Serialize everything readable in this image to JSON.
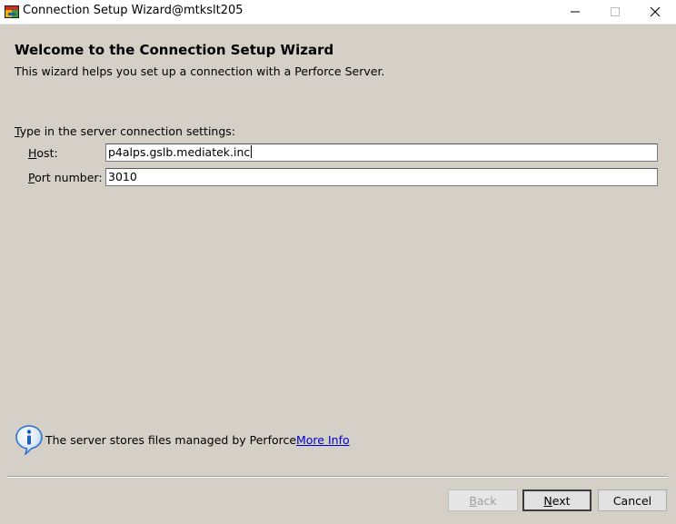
{
  "window": {
    "title": "Connection Setup Wizard@mtkslt205"
  },
  "wizard": {
    "heading": "Welcome to the Connection Setup Wizard",
    "subtitle": "This wizard helps you set up a connection with a Perforce Server.",
    "section_label_first": "T",
    "section_label_rest": "ype in the server connection settings:",
    "host": {
      "label_first": "H",
      "label_rest": "ost:",
      "value": "p4alps.gslb.mediatek.inc"
    },
    "port": {
      "label_first": "P",
      "label_rest": "ort number:",
      "value": "3010"
    },
    "info": {
      "text": "The server stores files managed by Perforce.",
      "link": "More Info",
      "icon": "info-icon"
    }
  },
  "buttons": {
    "back_first": "B",
    "back_rest": "ack",
    "next_first": "N",
    "next_rest": "ext",
    "cancel": "Cancel"
  },
  "colors": {
    "dialog_bg": "#d4d0c8",
    "link": "#0000cc",
    "info_icon": "#2a6fd0"
  }
}
